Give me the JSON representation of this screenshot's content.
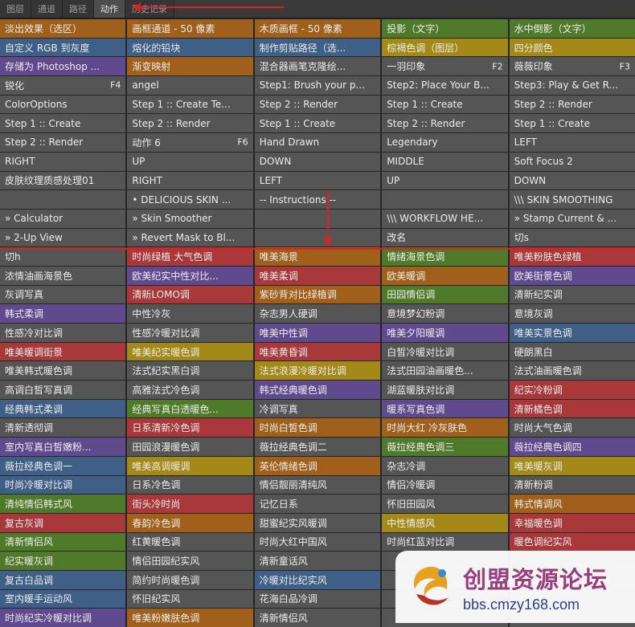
{
  "tabs": [
    {
      "label": "图层",
      "active": false
    },
    {
      "label": "通道",
      "active": false
    },
    {
      "label": "路径",
      "active": false
    },
    {
      "label": "动作",
      "active": true
    },
    {
      "label": "历史记录",
      "active": false
    }
  ],
  "colors": {
    "orange": "#a0601c",
    "yellow": "#a38a18",
    "green": "#4f7a2a",
    "blue": "#3f5f86",
    "purple": "#5f4a8e",
    "red": "#a8383a",
    "gray": "#555555",
    "dark": "#3c3c3c",
    "annotation": "#e02020"
  },
  "actions": [
    [
      {
        "label": "淡出效果（选区）",
        "color": "orange"
      },
      {
        "label": "画框通道 - 50 像素",
        "color": "orange"
      },
      {
        "label": "木质画框 - 50 像素",
        "color": "orange"
      },
      {
        "label": "投影（文字）",
        "color": "green"
      },
      {
        "label": "水中倒影（文字）",
        "color": "green"
      }
    ],
    [
      {
        "label": "自定义 RGB 到灰度",
        "color": "blue"
      },
      {
        "label": "熔化的铅块",
        "color": "blue"
      },
      {
        "label": "制作剪贴路径（选...",
        "color": "blue"
      },
      {
        "label": "棕褐色调（图层）",
        "color": "yellow"
      },
      {
        "label": "四分颜色",
        "color": "yellow"
      }
    ],
    [
      {
        "label": "存储为 Photoshop ...",
        "color": "purple"
      },
      {
        "label": "渐变映射",
        "color": "orange"
      },
      {
        "label": "混合器画笔克隆绘...",
        "color": "gray"
      },
      {
        "label": "一羽印象",
        "key": "F2",
        "color": "gray"
      },
      {
        "label": "薇薇印象",
        "key": "F3",
        "color": "gray"
      }
    ],
    [
      {
        "label": "锐化",
        "key": "F4",
        "color": "gray"
      },
      {
        "label": "angel",
        "color": "gray"
      },
      {
        "label": "Step1: Brush your p...",
        "color": "gray"
      },
      {
        "label": "Step2: Place Your B...",
        "color": "gray"
      },
      {
        "label": "Step3: Play & Get R...",
        "color": "gray"
      }
    ],
    [
      {
        "label": "ColorOptions",
        "color": "gray"
      },
      {
        "label": "Step 1 :: Create Te...",
        "color": "gray"
      },
      {
        "label": "Step 2 :: Render",
        "color": "gray"
      },
      {
        "label": "Step 1 :: Create",
        "color": "gray"
      },
      {
        "label": "Step 2 :: Render",
        "color": "gray"
      }
    ],
    [
      {
        "label": "Step 1 :: Create",
        "color": "gray"
      },
      {
        "label": "Step 2 :: Render",
        "color": "gray"
      },
      {
        "label": "Step 1 :: Create",
        "color": "gray"
      },
      {
        "label": "Step 2 :: Render",
        "color": "gray"
      },
      {
        "label": "Step 1 :: Create",
        "color": "gray"
      }
    ],
    [
      {
        "label": "Step 2 :: Render",
        "color": "gray"
      },
      {
        "label": "动作 6",
        "key": "F6",
        "color": "gray"
      },
      {
        "label": "Hand Drawn",
        "color": "gray"
      },
      {
        "label": "Legendary",
        "color": "gray"
      },
      {
        "label": "LEFT",
        "color": "gray"
      }
    ],
    [
      {
        "label": "RIGHT",
        "color": "gray"
      },
      {
        "label": "UP",
        "color": "gray"
      },
      {
        "label": "DOWN",
        "color": "gray"
      },
      {
        "label": "MIDDLE",
        "color": "gray"
      },
      {
        "label": "Soft Focus 2",
        "color": "gray"
      }
    ],
    [
      {
        "label": "皮肤纹理质感处理01",
        "color": "gray"
      },
      {
        "label": "RIGHT",
        "color": "gray"
      },
      {
        "label": "LEFT",
        "color": "gray"
      },
      {
        "label": "UP",
        "color": "gray"
      },
      {
        "label": "DOWN",
        "color": "gray"
      }
    ],
    [
      {
        "label": "",
        "color": "gray"
      },
      {
        "label": "• DELICIOUS SKIN ...",
        "color": "gray"
      },
      {
        "label": "-- Instructions --",
        "color": "gray"
      },
      {
        "label": "",
        "color": "gray"
      },
      {
        "label": "\\\\\\ SKIN SMOOTHING",
        "color": "gray"
      }
    ],
    [
      {
        "label": "» Calculator",
        "color": "gray"
      },
      {
        "label": "» Skin Smoother",
        "color": "gray"
      },
      {
        "label": "",
        "color": "gray"
      },
      {
        "label": "\\\\\\ WORKFLOW HE...",
        "color": "gray"
      },
      {
        "label": "» Stamp Current & ...",
        "color": "gray"
      }
    ],
    [
      {
        "label": "» 2-Up View",
        "color": "gray"
      },
      {
        "label": "» Revert Mask to Bl...",
        "color": "gray"
      },
      {
        "label": "",
        "color": "gray"
      },
      {
        "label": "改名",
        "color": "gray"
      },
      {
        "label": "切s",
        "color": "gray"
      }
    ],
    [
      {
        "label": "切h",
        "color": "gray"
      },
      {
        "label": "时尚绿植 大气色调",
        "color": "red"
      },
      {
        "label": "唯美海景",
        "color": "orange"
      },
      {
        "label": "情绪海景色调",
        "color": "green"
      },
      {
        "label": "唯美粉肤色绿植",
        "color": "red"
      }
    ],
    [
      {
        "label": "浓情油画海景色",
        "color": "gray"
      },
      {
        "label": "欧美纪实中性对比...",
        "color": "purple"
      },
      {
        "label": "唯美柔调",
        "color": "red"
      },
      {
        "label": "欧美暖调",
        "color": "orange"
      },
      {
        "label": "欧美街景色调",
        "color": "purple"
      }
    ],
    [
      {
        "label": "灰调写真",
        "color": "gray"
      },
      {
        "label": "清新LOMO调",
        "color": "red"
      },
      {
        "label": "紫砂背对比绿植调",
        "color": "orange"
      },
      {
        "label": "田园情侣调",
        "color": "green"
      },
      {
        "label": "清新纪实调",
        "color": "gray"
      }
    ],
    [
      {
        "label": "韩式柔调",
        "color": "purple"
      },
      {
        "label": "中性冷灰",
        "color": "gray"
      },
      {
        "label": "杂志男人硬调",
        "color": "gray"
      },
      {
        "label": "意境梦幻粉调",
        "color": "gray"
      },
      {
        "label": "意境灰调",
        "color": "gray"
      }
    ],
    [
      {
        "label": "性感冷对比调",
        "color": "gray"
      },
      {
        "label": "性感冷暖对比调",
        "color": "gray"
      },
      {
        "label": "唯美中性调",
        "color": "purple"
      },
      {
        "label": "唯美夕阳暖调",
        "color": "purple"
      },
      {
        "label": "唯美实景色调",
        "color": "blue"
      }
    ],
    [
      {
        "label": "唯美暖调街景",
        "color": "red"
      },
      {
        "label": "唯美纪实暖色调",
        "color": "yellow"
      },
      {
        "label": "唯美黄昏调",
        "color": "red"
      },
      {
        "label": "白皙冷暖对比调",
        "color": "gray"
      },
      {
        "label": "硬朗黑白",
        "color": "gray"
      }
    ],
    [
      {
        "label": "唯美韩式暖色调",
        "color": "gray"
      },
      {
        "label": "法式纪实黑白调",
        "color": "gray"
      },
      {
        "label": "法式浪漫冷暖对比调",
        "color": "yellow"
      },
      {
        "label": "法式田园油画暖色...",
        "color": "gray"
      },
      {
        "label": "法式油画暖色调",
        "color": "gray"
      }
    ],
    [
      {
        "label": "高调白皙写真调",
        "color": "gray"
      },
      {
        "label": "高雅法式冷色调",
        "color": "gray"
      },
      {
        "label": "韩式经典暖色调",
        "color": "purple"
      },
      {
        "label": "湖蓝暖肤对比调",
        "color": "gray"
      },
      {
        "label": "纪实冷粉调",
        "color": "red"
      }
    ],
    [
      {
        "label": "经典韩式柔调",
        "color": "blue"
      },
      {
        "label": "经典写真白透暖色...",
        "color": "green"
      },
      {
        "label": "冷调写真",
        "color": "gray"
      },
      {
        "label": "暖系写真色调",
        "color": "purple"
      },
      {
        "label": "清新橘色调",
        "color": "red"
      }
    ],
    [
      {
        "label": "清新透彻调",
        "color": "gray"
      },
      {
        "label": "日系清新冷色调",
        "color": "red"
      },
      {
        "label": "时尚白皙色调",
        "color": "orange"
      },
      {
        "label": "时尚大红 冷灰肤色",
        "color": "orange"
      },
      {
        "label": "时尚大气色调",
        "color": "gray"
      }
    ],
    [
      {
        "label": "室内写真白皙嫩粉...",
        "color": "purple"
      },
      {
        "label": "田园浪漫暖色调",
        "color": "gray"
      },
      {
        "label": "薇拉经典色调二",
        "color": "gray"
      },
      {
        "label": "薇拉经典色调三",
        "color": "green"
      },
      {
        "label": "薇拉经典色调四",
        "color": "purple"
      }
    ],
    [
      {
        "label": "薇拉经典色调一",
        "color": "blue"
      },
      {
        "label": "唯美高调暖调",
        "color": "yellow"
      },
      {
        "label": "英伦情绪色调",
        "color": "orange"
      },
      {
        "label": "杂志冷调",
        "color": "gray"
      },
      {
        "label": "唯美暖灰调",
        "color": "yellow"
      }
    ],
    [
      {
        "label": "时尚冷暖对比调",
        "color": "blue"
      },
      {
        "label": "日系冷色调",
        "color": "gray"
      },
      {
        "label": "情侣靓丽清纯风",
        "color": "gray"
      },
      {
        "label": "情侣冷暖调",
        "color": "gray"
      },
      {
        "label": "清新粉调",
        "color": "gray"
      }
    ],
    [
      {
        "label": "清纯情侣韩式风",
        "color": "green"
      },
      {
        "label": "街头冷时尚",
        "color": "red"
      },
      {
        "label": "记忆日系",
        "color": "gray"
      },
      {
        "label": "怀旧田园风",
        "color": "gray"
      },
      {
        "label": "韩式情调风",
        "color": "orange"
      }
    ],
    [
      {
        "label": "复古灰调",
        "color": "red"
      },
      {
        "label": "春韵冷色调",
        "color": "orange"
      },
      {
        "label": "甜蜜纪实风暖调",
        "color": "gray"
      },
      {
        "label": "中性情感风",
        "color": "yellow"
      },
      {
        "label": "幸福暖色调",
        "color": "red"
      }
    ],
    [
      {
        "label": "清新情侣风",
        "color": "green"
      },
      {
        "label": "红黄暖色调",
        "color": "gray"
      },
      {
        "label": "时尚大红中国风",
        "color": "gray"
      },
      {
        "label": "时尚红蓝对比调",
        "color": "gray"
      },
      {
        "label": "暖色调纪实风",
        "color": "red"
      }
    ],
    [
      {
        "label": "纪实暖灰调",
        "color": "green"
      },
      {
        "label": "情侣田园纪实风",
        "color": "gray"
      },
      {
        "label": "清新童话风",
        "color": "gray"
      },
      {
        "label": "",
        "color": "gray"
      },
      {
        "label": "",
        "color": "gray"
      }
    ],
    [
      {
        "label": "复古白品调",
        "color": "blue"
      },
      {
        "label": "简约时尚暖色调",
        "color": "gray"
      },
      {
        "label": "冷暖对比纪实风",
        "color": "blue"
      },
      {
        "label": "",
        "color": "gray"
      },
      {
        "label": "",
        "color": "gray"
      }
    ],
    [
      {
        "label": "室内暖手运动风",
        "color": "blue"
      },
      {
        "label": "怀旧纪实风",
        "color": "gray"
      },
      {
        "label": "花海白品冷调",
        "color": "gray"
      },
      {
        "label": "",
        "color": "gray"
      },
      {
        "label": "",
        "color": "gray"
      }
    ],
    [
      {
        "label": "时尚纪实冷暖对比调",
        "color": "purple"
      },
      {
        "label": "唯美粉嫩肤色调",
        "color": "orange"
      },
      {
        "label": "清新情侣风",
        "color": "gray"
      },
      {
        "label": "",
        "color": "gray"
      },
      {
        "label": "",
        "color": "gray"
      }
    ]
  ],
  "watermark": {
    "title": "创盟资源论坛",
    "url": "bbs.cmzy168.com"
  }
}
